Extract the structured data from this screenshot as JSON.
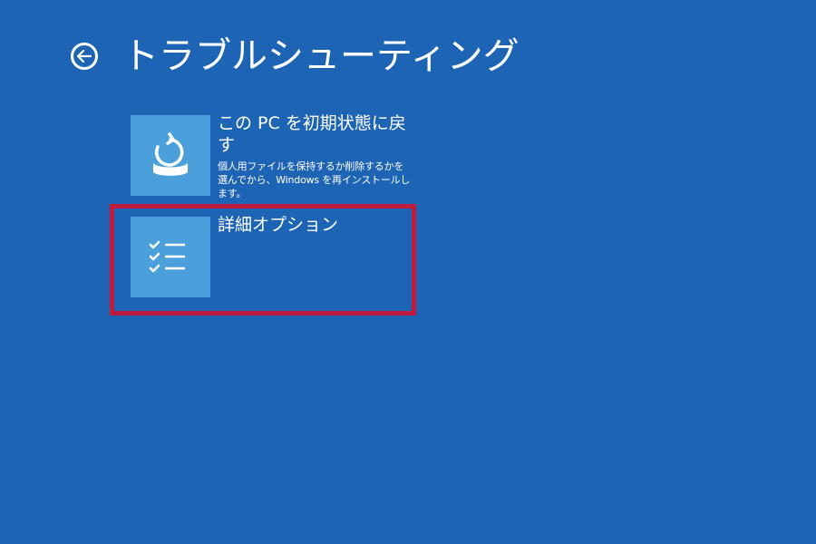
{
  "header": {
    "back_icon": "arrow-left-circle-icon",
    "title": "トラブルシューティング"
  },
  "options": [
    {
      "icon": "reset-pc-icon",
      "title": "この PC を初期状態に戻す",
      "description": "個人用ファイルを保持するか削除するかを選んでから、Windows を再インストールします。"
    },
    {
      "icon": "checklist-icon",
      "title": "詳細オプション",
      "description": ""
    }
  ],
  "colors": {
    "background": "#1e64b4",
    "tile": "#4ba0dc",
    "highlight": "#c01a3c",
    "text": "#ffffff"
  }
}
